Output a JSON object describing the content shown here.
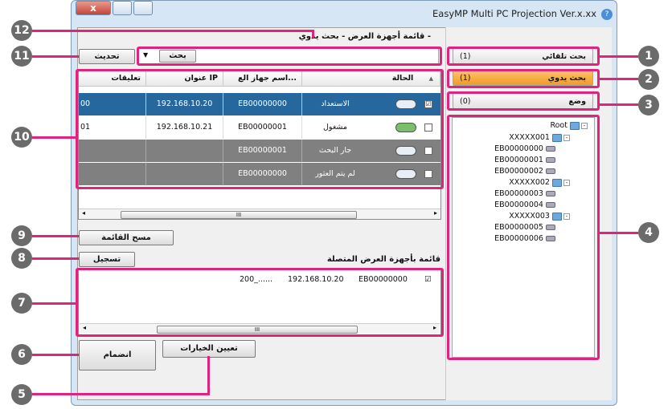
{
  "window": {
    "title": "EasyMP Multi PC Projection Ver.x.xx",
    "close_label": "x",
    "help_label": "?"
  },
  "header": {
    "list_title": "قائمة أجهزة العرض - بحث يدوي -",
    "search_label": "بحث",
    "refresh_label": "تحديث"
  },
  "tabs": [
    {
      "label": "بحث تلقائي",
      "count": "(1)"
    },
    {
      "label": "بحث يدوي",
      "count": "(1)"
    },
    {
      "label": "وضع",
      "count": "(0)"
    }
  ],
  "tree": {
    "root": "Root",
    "groups": [
      {
        "name": "XXXXX001",
        "items": [
          "EB00000000",
          "EB00000001",
          "EB00000002"
        ]
      },
      {
        "name": "XXXXX002",
        "items": [
          "EB00000003",
          "EB00000004"
        ]
      },
      {
        "name": "XXXXX003",
        "items": [
          "EB00000005",
          "EB00000006"
        ]
      }
    ]
  },
  "table": {
    "columns": [
      "تعليقات",
      "عنوان IP",
      "اسم جهاز الع...",
      "الحالة"
    ],
    "rows": [
      {
        "comment": "00",
        "ip": "192.168.10.20",
        "name": "EB00000000",
        "status": "الاستعداد",
        "checked": "☑"
      },
      {
        "comment": "01",
        "ip": "192.168.10.21",
        "name": "EB00000001",
        "status": "مشغول",
        "checked": ""
      },
      {
        "comment": "",
        "ip": "",
        "name": "EB00000001",
        "status": "جار البحث",
        "checked": ""
      },
      {
        "comment": "",
        "ip": "",
        "name": "EB00000000",
        "status": "لم يتم العثور",
        "checked": ""
      }
    ],
    "scroll_grip": "III"
  },
  "buttons": {
    "clear_list": "مسح القائمة",
    "register": "تسجيل",
    "set_options": "تعيين الخيارات",
    "join": "انضمام"
  },
  "connected": {
    "title": "قائمة بأجهزة العرض المتصلة",
    "rows": [
      {
        "checked": "☑",
        "name": "EB00000000",
        "ip": "192.168.10.20",
        "comment": "200_......"
      }
    ],
    "scroll_grip": "III"
  },
  "callouts": [
    "1",
    "2",
    "3",
    "4",
    "5",
    "6",
    "7",
    "8",
    "9",
    "10",
    "11",
    "12"
  ],
  "accent_color": "#e0237c"
}
